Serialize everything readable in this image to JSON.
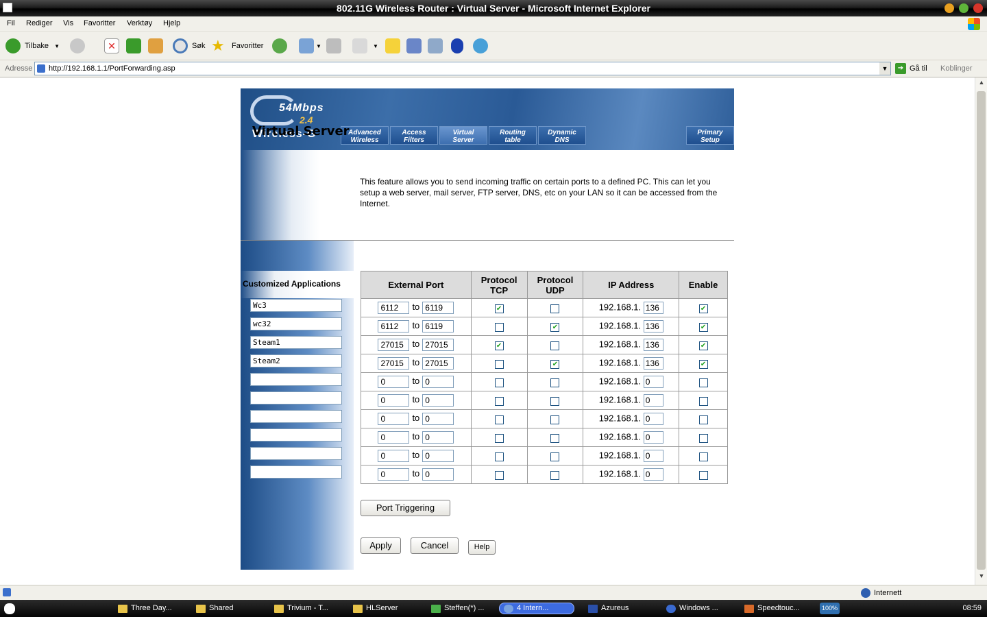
{
  "window": {
    "title": "802.11G Wireless Router : Virtual Server - Microsoft Internet Explorer"
  },
  "menu": {
    "items": [
      "Fil",
      "Rediger",
      "Vis",
      "Favoritter",
      "Verktøy",
      "Hjelp"
    ]
  },
  "toolbar": {
    "back_label": "Tilbake",
    "search_label": "Søk",
    "favorites_label": "Favoritter"
  },
  "address": {
    "label": "Adresse",
    "url": "http://192.168.1.1/PortForwarding.asp",
    "go_label": "Gå til",
    "links_label": "Koblinger"
  },
  "router": {
    "logo_speed": "54Mbps",
    "logo_band": "2.4",
    "logo_brand": "Wireless-G",
    "tabs": [
      {
        "label": "Advanced\nWireless"
      },
      {
        "label": "Access\nFilters"
      },
      {
        "label": "Virtual\nServer"
      },
      {
        "label": "Routing\ntable"
      },
      {
        "label": "Dynamic\nDNS"
      },
      {
        "label": "Primary\nSetup"
      }
    ],
    "active_tab": "Virtual Server",
    "page_title": "Virtual Server",
    "intro": "This feature allows you to send incoming traffic on certain ports to a defined PC. This can let you setup a web server, mail server, FTP server, DNS, etc on your LAN so it can be accessed from the Internet.",
    "custom_apps_header": "Customized Applications",
    "columns": {
      "external_port": "External Port",
      "tcp": "Protocol\nTCP",
      "udp": "Protocol\nUDP",
      "ip": "IP Address",
      "enable": "Enable"
    },
    "to_word": "to",
    "ip_prefix": "192.168.1.",
    "rules": [
      {
        "app": "Wc3",
        "port_from": "6112",
        "port_to": "6119",
        "tcp": true,
        "udp": false,
        "ip_last": "136",
        "enabled": true
      },
      {
        "app": "wc32",
        "port_from": "6112",
        "port_to": "6119",
        "tcp": false,
        "udp": true,
        "ip_last": "136",
        "enabled": true
      },
      {
        "app": "Steam1",
        "port_from": "27015",
        "port_to": "27015",
        "tcp": true,
        "udp": false,
        "ip_last": "136",
        "enabled": true
      },
      {
        "app": "Steam2",
        "port_from": "27015",
        "port_to": "27015",
        "tcp": false,
        "udp": true,
        "ip_last": "136",
        "enabled": true
      },
      {
        "app": "",
        "port_from": "0",
        "port_to": "0",
        "tcp": false,
        "udp": false,
        "ip_last": "0",
        "enabled": false
      },
      {
        "app": "",
        "port_from": "0",
        "port_to": "0",
        "tcp": false,
        "udp": false,
        "ip_last": "0",
        "enabled": false
      },
      {
        "app": "",
        "port_from": "0",
        "port_to": "0",
        "tcp": false,
        "udp": false,
        "ip_last": "0",
        "enabled": false
      },
      {
        "app": "",
        "port_from": "0",
        "port_to": "0",
        "tcp": false,
        "udp": false,
        "ip_last": "0",
        "enabled": false
      },
      {
        "app": "",
        "port_from": "0",
        "port_to": "0",
        "tcp": false,
        "udp": false,
        "ip_last": "0",
        "enabled": false
      },
      {
        "app": "",
        "port_from": "0",
        "port_to": "0",
        "tcp": false,
        "udp": false,
        "ip_last": "0",
        "enabled": false
      }
    ],
    "buttons": {
      "port_triggering": "Port Triggering",
      "apply": "Apply",
      "cancel": "Cancel",
      "help": "Help"
    }
  },
  "status": {
    "zone": "Internett"
  },
  "taskbar": {
    "items": [
      "Three Day...",
      "Shared",
      "Trivium - T...",
      "HLServer",
      "Steffen(*) ...",
      "4 Intern...",
      "Azureus",
      "Windows ...",
      "Speedtouc..."
    ],
    "tray_zoom": "100%",
    "clock": "08:59"
  },
  "icons": [
    "back-icon",
    "forward-icon",
    "stop-icon",
    "refresh-icon",
    "home-icon",
    "search-icon",
    "favorites-star-icon",
    "history-icon",
    "mail-icon",
    "print-icon",
    "edit-icon",
    "notes-icon",
    "messenger-icon",
    "bluetooth-icon",
    "page-icon",
    "go-arrow-icon",
    "internet-zone-icon",
    "start-icon"
  ]
}
